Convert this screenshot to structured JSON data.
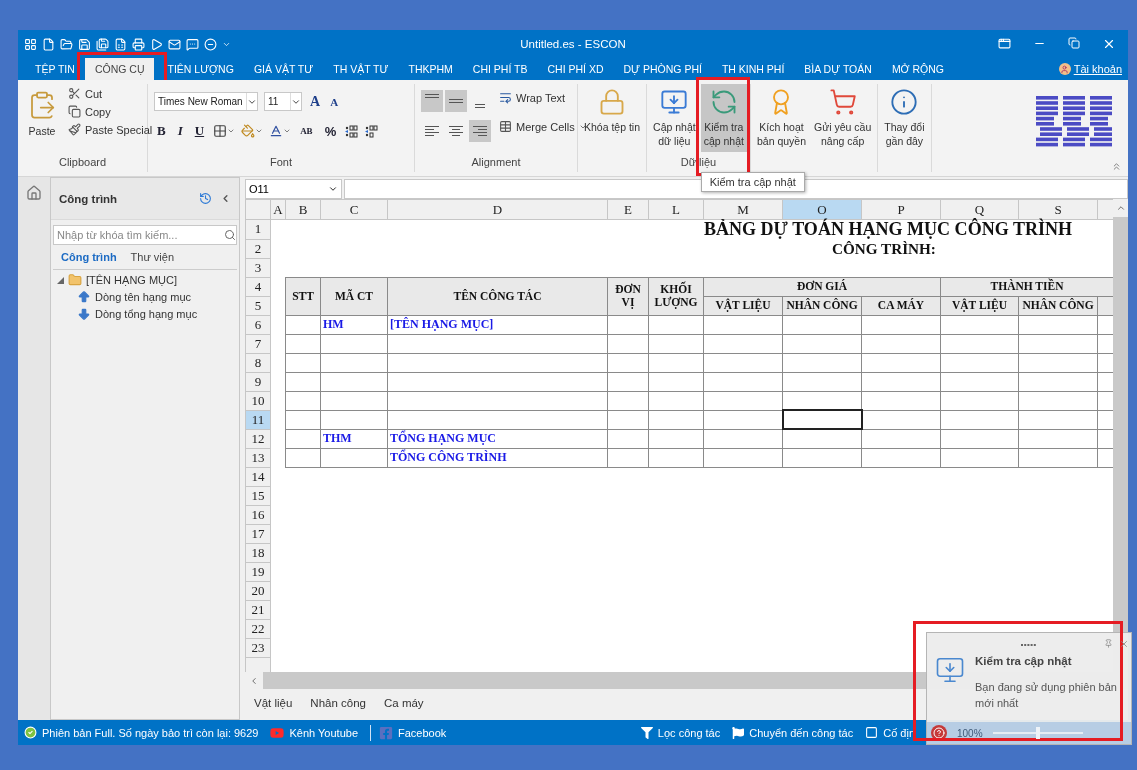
{
  "window": {
    "title": "Untitled.es - ESCON"
  },
  "ribbon_tabs": [
    {
      "label": "TỆP TIN",
      "selected": false,
      "highlighted": false
    },
    {
      "label": "CÔNG CỤ",
      "selected": true,
      "highlighted": true
    },
    {
      "label": "TIÊN LƯỢNG",
      "selected": false,
      "highlighted": false
    },
    {
      "label": "GIÁ VẬT TƯ",
      "selected": false,
      "highlighted": false
    },
    {
      "label": "TH VẬT TƯ",
      "selected": false,
      "highlighted": false
    },
    {
      "label": "THKPHM",
      "selected": false,
      "highlighted": false
    },
    {
      "label": "CHI PHÍ TB",
      "selected": false,
      "highlighted": false
    },
    {
      "label": "CHI PHÍ XD",
      "selected": false,
      "highlighted": false
    },
    {
      "label": "DỰ PHÒNG PHÍ",
      "selected": false,
      "highlighted": false
    },
    {
      "label": "TH KINH PHÍ",
      "selected": false,
      "highlighted": false
    },
    {
      "label": "BÌA DỰ TOÁN",
      "selected": false,
      "highlighted": false
    },
    {
      "label": "MỞ RỘNG",
      "selected": false,
      "highlighted": false
    }
  ],
  "account": {
    "label": "Tài khoản"
  },
  "ribbon": {
    "clipboard": {
      "label": "Clipboard",
      "paste": "Paste",
      "items": [
        "Cut",
        "Copy",
        "Paste Special"
      ]
    },
    "font": {
      "label": "Font",
      "name": "Times New Roman",
      "size": "11",
      "size_buttons": [
        "A",
        "A"
      ],
      "style_buttons": [
        "B",
        "I",
        "U"
      ],
      "case_button": "AB",
      "percent_button": "%"
    },
    "alignment": {
      "label": "Alignment",
      "align_buttons": [
        {
          "kind": "top",
          "selected": true
        },
        {
          "kind": "middle",
          "selected": true
        },
        {
          "kind": "bottom",
          "selected": false
        },
        {
          "kind": "left",
          "selected": false
        },
        {
          "kind": "center",
          "selected": false
        },
        {
          "kind": "right",
          "selected": true
        }
      ],
      "wrap_text": "Wrap Text",
      "merge_cells": "Merge Cells"
    },
    "data_groups": [
      {
        "buttons": [
          {
            "label": "Khóa tệp tin",
            "selected": false,
            "highlighted": false
          }
        ]
      },
      {
        "label": "Dữ liệu",
        "buttons": [
          {
            "label": "Cập nhật\ndữ liệu",
            "selected": false,
            "highlighted": false
          },
          {
            "label": "Kiểm tra\ncập nhật",
            "selected": true,
            "highlighted": true,
            "tooltip": "Kiểm tra cập nhật"
          }
        ]
      },
      {
        "buttons": [
          {
            "label": "Kích hoạt\nbản quyền",
            "selected": false,
            "highlighted": false
          },
          {
            "label": "Gửi yêu cầu\nnâng cấp",
            "selected": false,
            "highlighted": false
          }
        ]
      },
      {
        "buttons": [
          {
            "label": "Thay đổi\ngần đây",
            "selected": false,
            "highlighted": false
          }
        ]
      }
    ]
  },
  "panel": {
    "title": "Công trình",
    "search": {
      "placeholder": "Nhập từ khóa tìm kiếm..."
    },
    "tabs": [
      {
        "label": "Công trình",
        "selected": true
      },
      {
        "label": "Thư viện",
        "selected": false
      }
    ],
    "tree": [
      {
        "label": "[TÊN HẠNG MỤC]",
        "kind": "folder",
        "expanded": true,
        "children": [
          {
            "label": "Dòng tên hạng mục",
            "kind": "up"
          },
          {
            "label": "Dòng tổng hạng mục",
            "kind": "down"
          }
        ]
      }
    ]
  },
  "sheet": {
    "name_box": "O11",
    "columns": [
      {
        "label": "A",
        "selected": false
      },
      {
        "label": "B",
        "selected": false
      },
      {
        "label": "C",
        "selected": false
      },
      {
        "label": "D",
        "selected": false
      },
      {
        "label": "E",
        "selected": false
      },
      {
        "label": "L",
        "selected": false
      },
      {
        "label": "M",
        "selected": false
      },
      {
        "label": "O",
        "selected": true
      },
      {
        "label": "P",
        "selected": false
      },
      {
        "label": "Q",
        "selected": false
      },
      {
        "label": "S",
        "selected": false
      }
    ],
    "row_numbers": [
      {
        "label": "1",
        "selected": false
      },
      {
        "label": "2",
        "selected": false
      },
      {
        "label": "3",
        "selected": false
      },
      {
        "label": "4",
        "selected": false
      },
      {
        "label": "5",
        "selected": false
      },
      {
        "label": "6",
        "selected": false
      },
      {
        "label": "7",
        "selected": false
      },
      {
        "label": "8",
        "selected": false
      },
      {
        "label": "9",
        "selected": false
      },
      {
        "label": "10",
        "selected": false
      },
      {
        "label": "11",
        "selected": true
      },
      {
        "label": "12",
        "selected": false
      },
      {
        "label": "13",
        "selected": false
      },
      {
        "label": "14",
        "selected": false
      },
      {
        "label": "15",
        "selected": false
      },
      {
        "label": "16",
        "selected": false
      },
      {
        "label": "17",
        "selected": false
      },
      {
        "label": "18",
        "selected": false
      },
      {
        "label": "19",
        "selected": false
      },
      {
        "label": "20",
        "selected": false
      },
      {
        "label": "21",
        "selected": false
      },
      {
        "label": "22",
        "selected": false
      },
      {
        "label": "23",
        "selected": false
      }
    ],
    "title": "BẢNG DỰ TOÁN HẠNG MỤC CÔNG TRÌNH",
    "subtitle": "CÔNG TRÌNH:",
    "header_top": [
      {
        "label": "STT",
        "kind": "single"
      },
      {
        "label": "MÃ CT",
        "kind": "single"
      },
      {
        "label": "TÊN CÔNG TÁC",
        "kind": "single"
      },
      {
        "label": "ĐƠN VỊ",
        "kind": "single"
      },
      {
        "label": "KHỐI LƯỢNG",
        "kind": "single"
      },
      {
        "label": "ĐƠN GIÁ",
        "kind": "group"
      },
      {
        "label": "THÀNH TIỀN",
        "kind": "group"
      }
    ],
    "header_sub": [
      "VẬT LIỆU",
      "NHÂN CÔNG",
      "CA MÁY",
      "VẬT LIỆU",
      "NHÂN CÔNG"
    ],
    "rows": [
      {
        "kind": "item",
        "code": "HM",
        "name": "[TÊN HẠNG MỤC]"
      },
      {
        "kind": "blank"
      },
      {
        "kind": "blank"
      },
      {
        "kind": "blank"
      },
      {
        "kind": "blank"
      },
      {
        "kind": "blank"
      },
      {
        "kind": "item",
        "code": "THM",
        "name": "TỔNG HẠNG MỤC"
      },
      {
        "kind": "item",
        "name": "TỔNG CÔNG TRÌNH"
      }
    ],
    "tabs": [
      "Vật liệu",
      "Nhân công",
      "Ca máy"
    ]
  },
  "status_bar": {
    "left": [
      {
        "kind": "check",
        "label": "Phiên bản Full. Số ngày bảo trì còn lại: 9629"
      },
      {
        "kind": "youtube",
        "label": "Kênh Youtube"
      },
      {
        "kind": "facebook",
        "label": "Facebook"
      }
    ],
    "right": [
      {
        "kind": "filter",
        "label": "Lọc công tác"
      },
      {
        "kind": "flag",
        "label": "Chuyển đến công tác"
      },
      {
        "kind": "frame",
        "label": "Cố địn"
      }
    ]
  },
  "popup": {
    "title": "Kiểm tra cập nhật",
    "message": "Bạn đang sử dụng phiên bản mới nhất",
    "highlighted": true,
    "zoom": {
      "reading": "100%",
      "level": 0.5
    }
  }
}
